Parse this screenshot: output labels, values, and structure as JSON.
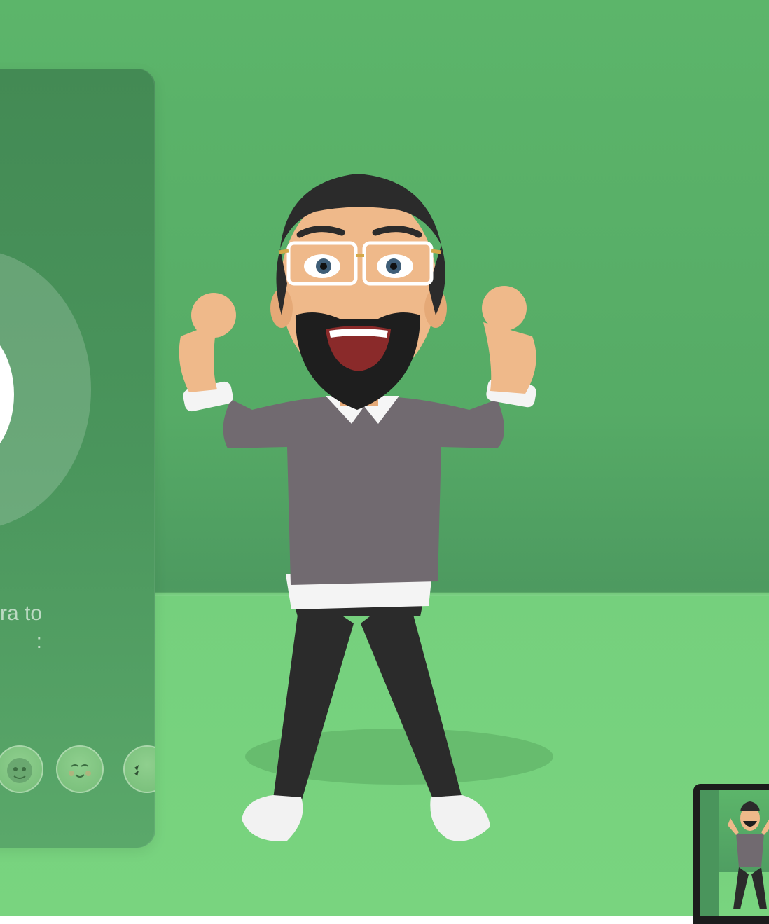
{
  "panel": {
    "hint_text": "ra to\n:"
  },
  "reactions": [
    {
      "icon": "reaction-face-1-icon"
    },
    {
      "icon": "reaction-face-2-icon"
    },
    {
      "icon": "reaction-face-3-icon"
    }
  ],
  "colors": {
    "wall": "#5cb56a",
    "floor": "#79d47f",
    "panel": "#4a955c",
    "shirt": "#726a70",
    "pants": "#2a2a2a"
  }
}
